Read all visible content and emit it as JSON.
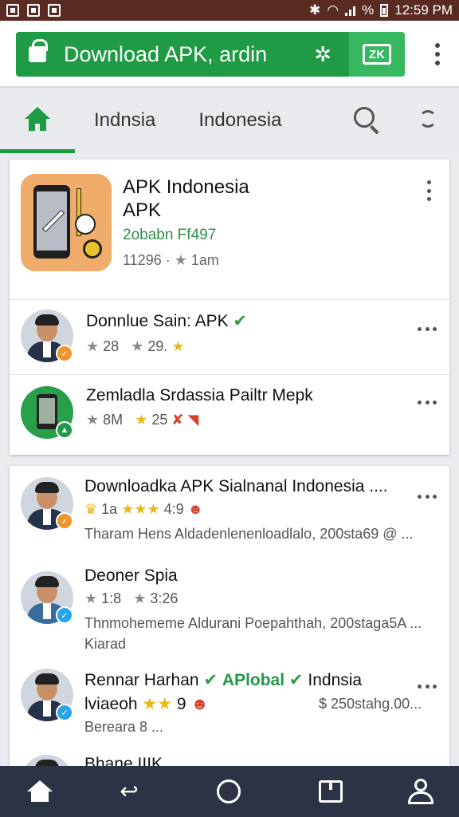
{
  "status_bar": {
    "time": "12:59 PM",
    "battery_label": "%"
  },
  "header": {
    "download_label": "Download APK, ardin",
    "spark_glyph": "✲",
    "badge_text": "ZK"
  },
  "tabs": [
    {
      "label": "Indnsia"
    },
    {
      "label": "Indonesia"
    }
  ],
  "featured": {
    "title_line1": "APK Indonesia",
    "title_line2": "APK",
    "subtitle": "2obabn Ff497",
    "meta_count": "11296",
    "meta_time": "1am"
  },
  "rows_card1": [
    {
      "title": "Donnlue Sain: APK",
      "rating_a": "28",
      "rating_b": "29."
    },
    {
      "title": "Zemladla Srdassia Pailtr Mepk",
      "rating_a": "8M",
      "rating_b": "25"
    }
  ],
  "rows_card2": [
    {
      "title": "Downloadka APK Sialnanal Indonesia ....",
      "meta_a": "1a",
      "meta_b": "4:9",
      "desc": "Tharam Hens Aldadenlenenloadlalo, 200sta69 @ ..."
    },
    {
      "title": "Deoner Spia",
      "meta_a": "1:8",
      "meta_b": "3:26",
      "desc": "Thnmohememe Aldurani Poepahthah, 200staga5A ...",
      "desc2": "Kiarad"
    },
    {
      "title_a": "Rennar Harhan",
      "title_b": "APlobal",
      "title_c": "Indnsia",
      "meta_a": "lviaeoh",
      "meta_b": "9",
      "right_meta": "$ 250stahg.00...",
      "desc": "Bereara 8 ..."
    },
    {
      "title": "Bhane IIIK"
    }
  ],
  "colors": {
    "accent": "#1f9a45",
    "status_bar": "#5a2b22",
    "bottom_nav": "#2b3344",
    "app_icon": "#efac6a"
  }
}
